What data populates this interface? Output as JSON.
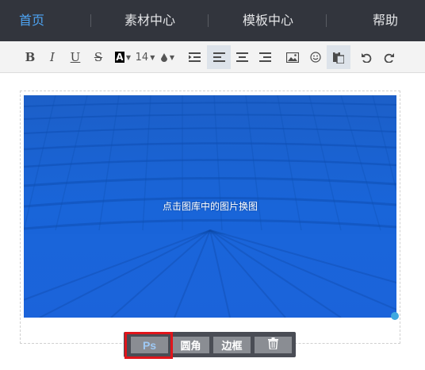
{
  "nav": {
    "items": [
      {
        "label": "首页",
        "active": true
      },
      {
        "label": "素材中心",
        "active": false
      },
      {
        "label": "模板中心",
        "active": false
      },
      {
        "label": "帮助",
        "active": false
      }
    ]
  },
  "toolbar": {
    "bold": "B",
    "italic": "I",
    "underline": "U",
    "strike": "S",
    "font_color": "A",
    "font_size": "14",
    "icons": [
      "bold-icon",
      "italic-icon",
      "underline-icon",
      "strikethrough-icon",
      "font-color-icon",
      "font-size-select",
      "fill-color-icon",
      "indent-icon",
      "align-left-icon",
      "align-center-icon",
      "align-right-icon",
      "image-icon",
      "emoji-icon",
      "paste-icon",
      "undo-icon",
      "redo-icon"
    ]
  },
  "canvas": {
    "hint": "点击图库中的图片换图"
  },
  "image_actions": {
    "ps": "Ps",
    "rounded": "圆角",
    "border": "边框",
    "delete_icon": "trash-icon"
  },
  "colors": {
    "nav_bg": "#32353d",
    "nav_active": "#4da3f2",
    "photo_tint": "#1a5fd0",
    "highlight": "#e0151b"
  }
}
